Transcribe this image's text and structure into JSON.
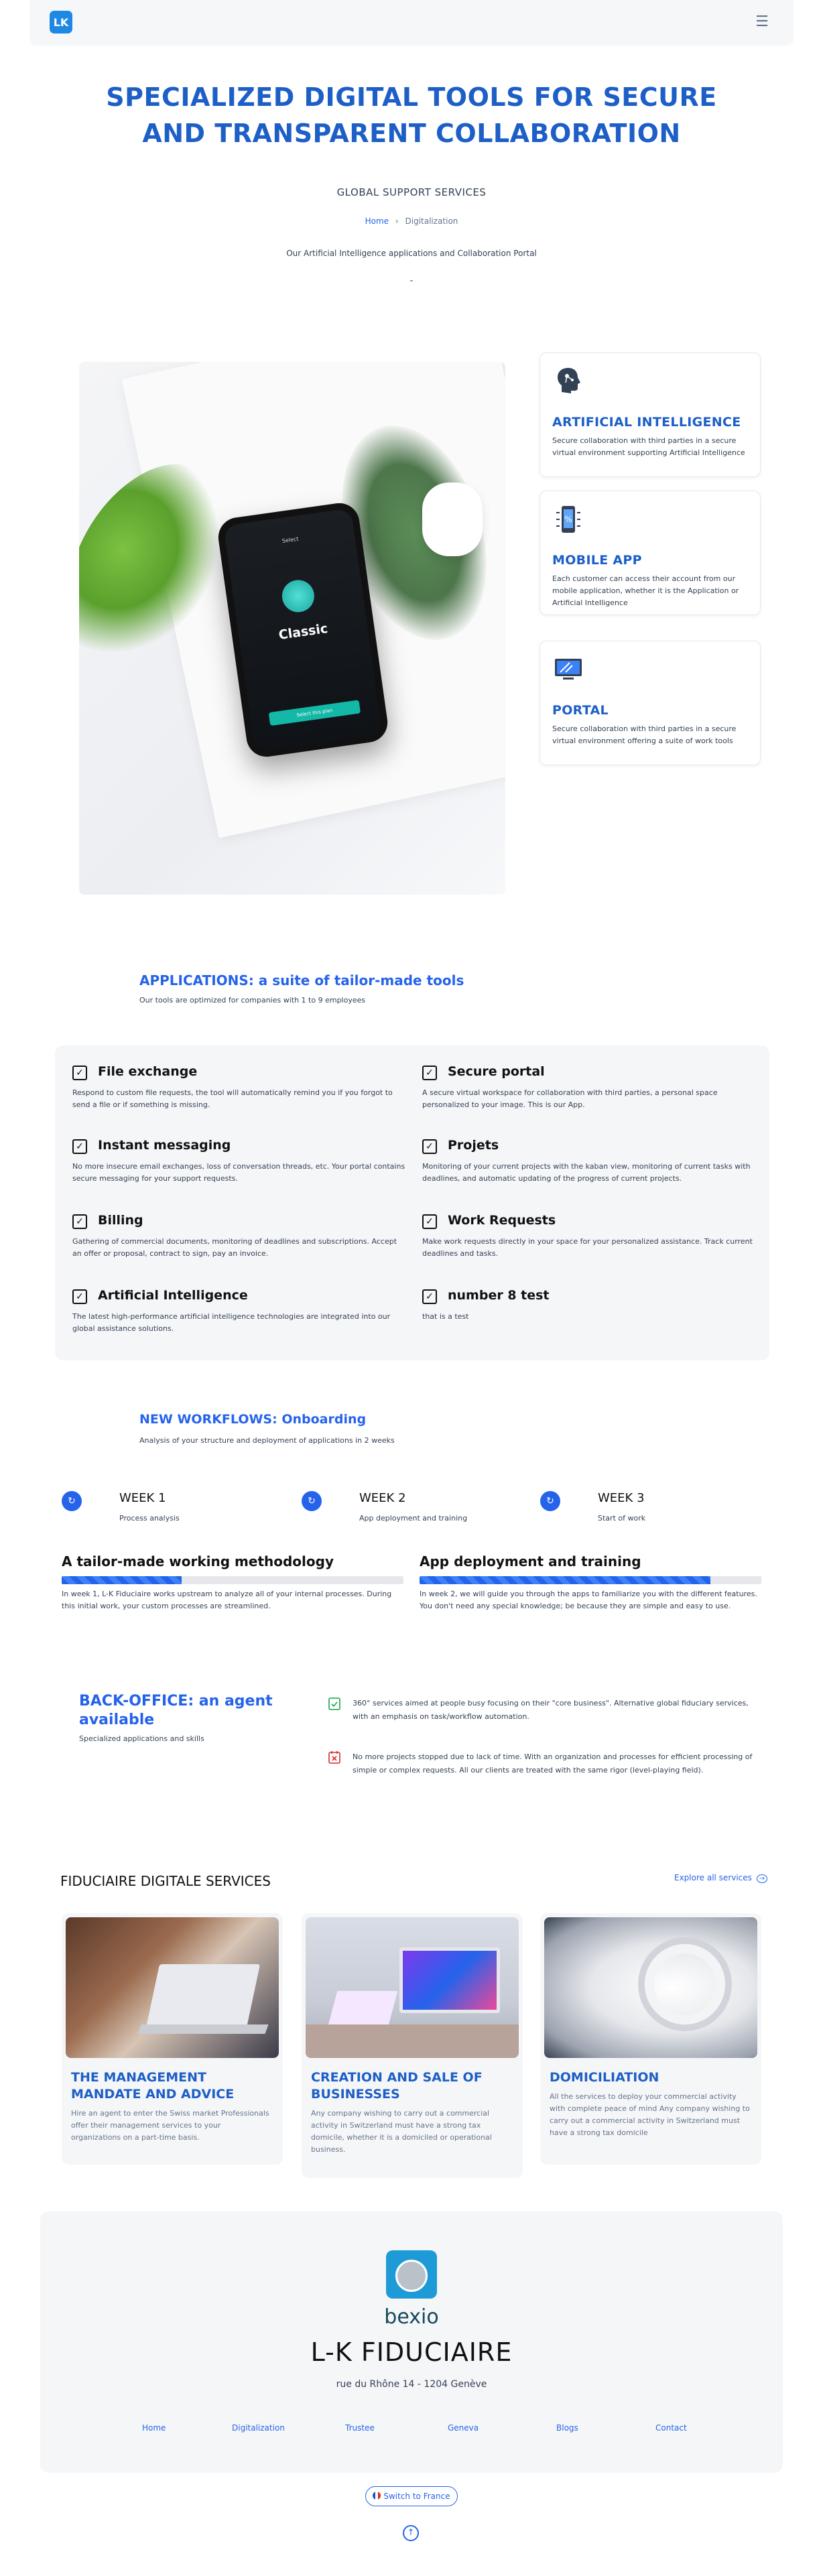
{
  "header": {
    "logo_text": "LK",
    "menu_icon": "hamburger-menu-icon"
  },
  "hero": {
    "title": "SPECIALIZED DIGITAL TOOLS FOR SECURE AND TRANSPARENT COLLABORATION",
    "subtitle": "GLOBAL SUPPORT SERVICES",
    "breadcrumb": {
      "home": "Home",
      "separator": ">",
      "current": "Digitalization"
    },
    "portal_text": "Our Artificial Intelligence applications and Collaboration Portal"
  },
  "phone_screen": {
    "top": "Select ",
    "label": "Classic",
    "button": "Select this plan"
  },
  "features": [
    {
      "icon": "ai-head-icon",
      "title": "ARTIFICIAL INTELLIGENCE",
      "text": "Secure collaboration with third parties in a secure virtual environment supporting Artificial Intelligence"
    },
    {
      "icon": "mobile-app-icon",
      "title": "MOBILE APP",
      "text": "Each customer can access their account from our mobile application, whether it is the Application or Artificial Intelligence"
    },
    {
      "icon": "portal-monitor-icon",
      "title": "PORTAL",
      "text": "Secure collaboration with third parties in a secure virtual environment offering a suite of work tools"
    }
  ],
  "applications": {
    "title": "APPLICATIONS: a suite of tailor-made tools",
    "subtitle": "Our tools are optimized for companies with 1 to 9 employees",
    "items": [
      {
        "title": "File exchange",
        "text": "Respond to custom file requests, the tool will automatically remind you if you forgot to send a file or if something is missing."
      },
      {
        "title": "Secure portal",
        "text": "A secure virtual workspace for collaboration with third parties, a personal space personalized to your image. This is our App."
      },
      {
        "title": "Instant messaging",
        "text": "No more insecure email exchanges, loss of conversation threads, etc. Your portal contains secure messaging for your support requests."
      },
      {
        "title": "Projets",
        "text": "Monitoring of your current projects with the kaban view, monitoring of current tasks with deadlines, and automatic updating of the progress of current projects."
      },
      {
        "title": "Billing",
        "text": "Gathering of commercial documents, monitoring of deadlines and subscriptions. Accept an offer or proposal, contract to sign, pay an invoice."
      },
      {
        "title": "Work Requests",
        "text": "Make work requests directly in your space for your personalized assistance. Track current deadlines and tasks."
      },
      {
        "title": "Artificial Intelligence",
        "text": "The latest high-performance artificial intelligence technologies are integrated into our global assistance solutions."
      },
      {
        "title": "number 8 test",
        "text": "that is a test"
      }
    ]
  },
  "workflows": {
    "title": "NEW WORKFLOWS: Onboarding",
    "subtitle": "Analysis of your structure and deployment of applications in 2 weeks",
    "weeks": [
      {
        "title": "WEEK 1",
        "sub": "Process analysis"
      },
      {
        "title": "WEEK 2",
        "sub": "App deployment and training"
      },
      {
        "title": "WEEK 3",
        "sub": "Start of work"
      }
    ],
    "methods": [
      {
        "title": "A tailor-made working methodology",
        "progress": 0.35,
        "text": "In week 1, L-K Fiduciaire works upstream to analyze all of your internal processes. During this initial work, your custom processes are streamlined."
      },
      {
        "title": "App deployment and training",
        "progress": 0.85,
        "text": "In week 2, we will guide you through the apps to familiarize you with the different features. You don't need any special knowledge; be because they are simple and easy to use."
      }
    ]
  },
  "backoffice": {
    "title": "BACK-OFFICE: an agent available",
    "subtitle": "Specialized applications and skills",
    "items": [
      {
        "icon": "clipboard-check-icon",
        "text": "360° services aimed at people busy focusing on their \"core business\". Alternative global fiduciary services, with an emphasis on task/workflow automation."
      },
      {
        "icon": "calendar-x-icon",
        "text": "No more projects stopped due to lack of time. With an organization and processes for efficient processing of simple or complex requests. All our clients are treated with the same rigor (level-playing field)."
      }
    ]
  },
  "services": {
    "title": "FIDUCIAIRE DIGITALE SERVICES",
    "link": "Explore all services",
    "items": [
      {
        "title": "THE MANAGEMENT MANDATE AND ADVICE",
        "text": "Hire an agent to enter the Swiss market Professionals offer their management services to your organizations on a part-time basis."
      },
      {
        "title": "CREATION AND SALE OF BUSINESSES",
        "text": "Any company wishing to carry out a commercial activity in Switzerland must have a strong tax domicile, whether it is a domiciled or operational business."
      },
      {
        "title": "DOMICILIATION",
        "text": "All the services to deploy your commercial activity with complete peace of mind Any company wishing to carry out a commercial activity in Switzerland must have a strong tax domicile"
      }
    ]
  },
  "footer": {
    "partner": "bexio",
    "company": "L-K FIDUCIAIRE",
    "address": "rue du Rhône 14 - 1204 Genève",
    "links": [
      "Home",
      "Digitalization",
      "Trustee",
      "Geneva",
      "Blogs",
      "Contact"
    ],
    "switch": "Switch to France"
  },
  "colors": {
    "accent": "#2563eb",
    "title_blue": "#1d5fc7"
  }
}
